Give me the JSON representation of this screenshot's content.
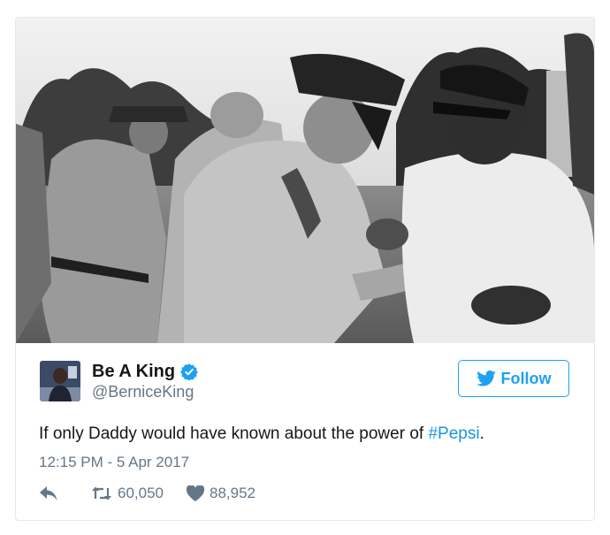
{
  "tweet": {
    "display_name": "Be A King",
    "handle": "@BerniceKing",
    "follow_label": "Follow",
    "text_before": "If only Daddy would have known about the power of ",
    "hashtag": "#Pepsi",
    "text_after": ".",
    "timestamp": "12:15 PM - 5 Apr 2017",
    "retweets": "60,050",
    "likes": "88,952"
  },
  "icons": {
    "verified": "verified-badge-icon",
    "follow": "twitter-bird-icon",
    "reply": "reply-icon",
    "retweet": "retweet-icon",
    "like": "heart-icon"
  },
  "colors": {
    "accent": "#1da1f2",
    "hashtag": "#1b95e0",
    "secondary_text": "#657786",
    "border": "#e1e8ed"
  }
}
